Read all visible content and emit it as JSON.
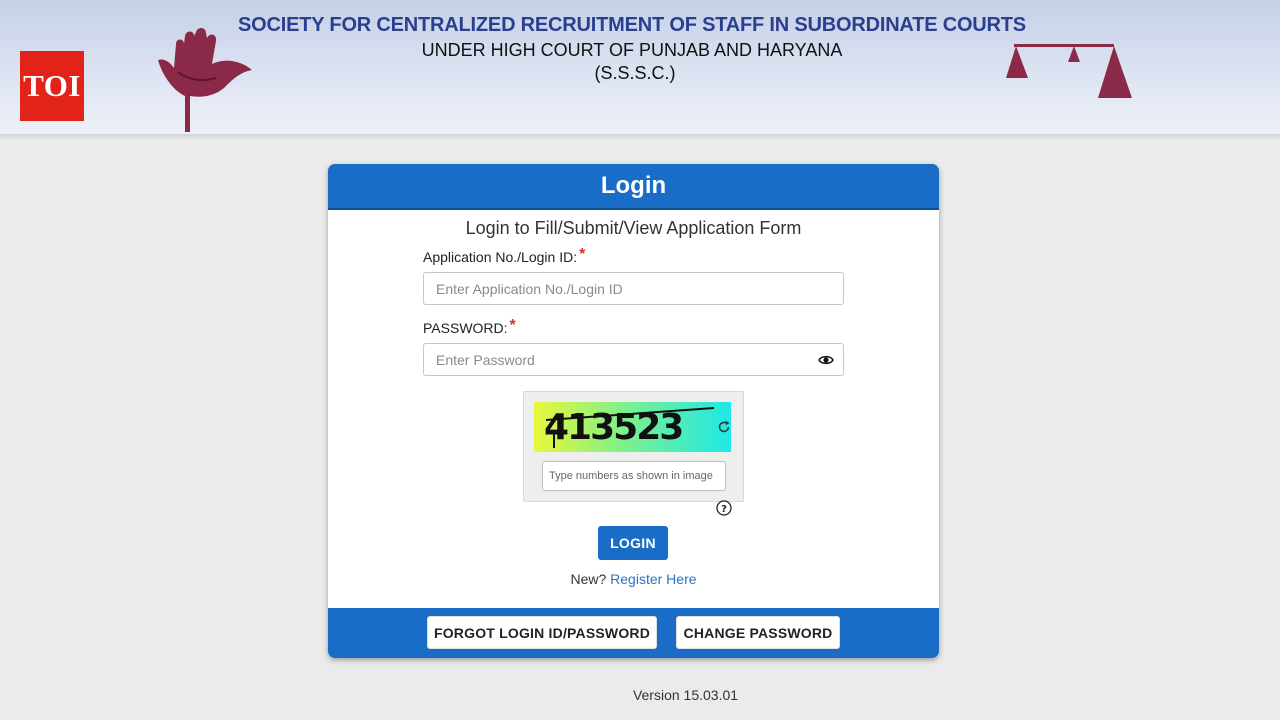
{
  "header": {
    "logo_text": "TOI",
    "title_line1": "SOCIETY FOR CENTRALIZED RECRUITMENT OF STAFF IN SUBORDINATE COURTS",
    "title_line2": "UNDER HIGH COURT OF PUNJAB AND HARYANA",
    "title_line3": "(S.S.S.C.)",
    "left_emblem_icon": "open-hand-emblem-icon",
    "right_emblem_icon": "scales-emblem-icon"
  },
  "login_card": {
    "title": "Login",
    "subtitle": "Login to Fill/Submit/View Application Form",
    "app_no_label": "Application No./Login ID:",
    "required_mark": "*",
    "app_no_placeholder": "Enter Application No./Login ID",
    "password_label": "PASSWORD:",
    "password_placeholder": "Enter Password",
    "captcha_text": "413523",
    "captcha_placeholder": "Type numbers as shown in image",
    "login_button": "LOGIN",
    "register_prefix": "New?",
    "register_link": "Register Here",
    "forgot_button": "FORGOT LOGIN ID/PASSWORD",
    "change_password_button": "CHANGE PASSWORD"
  },
  "footer": {
    "version": "Version 15.03.01"
  },
  "colors": {
    "primary_blue": "#1a6dc6",
    "title_blue": "#2a3f8f",
    "required_red": "#d32f2f",
    "toi_red": "#e2231a",
    "emblem_maroon": "#8a2a48"
  }
}
